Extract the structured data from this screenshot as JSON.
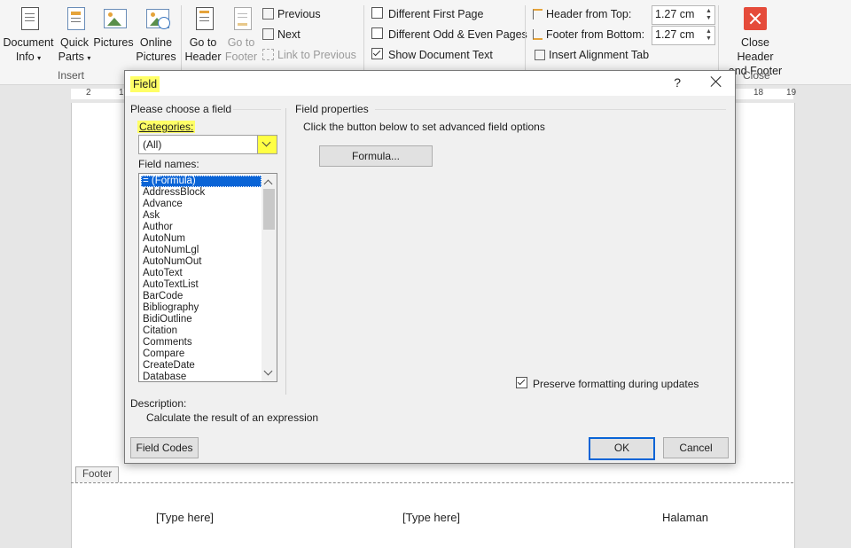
{
  "ribbon": {
    "insert_group": {
      "label": "Insert",
      "document_info": {
        "line1": "Document",
        "line2": "Info"
      },
      "quick_parts": {
        "line1": "Quick",
        "line2": "Parts"
      },
      "pictures": {
        "line1": "Pictures"
      },
      "online_pictures": {
        "line1": "Online",
        "line2": "Pictures"
      }
    },
    "navigation": {
      "go_to_header": {
        "line1": "Go to",
        "line2": "Header"
      },
      "go_to_footer": {
        "line1": "Go to",
        "line2": "Footer"
      },
      "previous": "Previous",
      "next": "Next",
      "link_to_previous": "Link to Previous"
    },
    "options": {
      "different_first_page": "Different First Page",
      "different_odd_even": "Different Odd & Even Pages",
      "show_document_text": "Show Document Text",
      "show_document_text_checked": true
    },
    "position": {
      "header_from_top_label": "Header from Top:",
      "header_from_top_value": "1.27 cm",
      "footer_from_bottom_label": "Footer from Bottom:",
      "footer_from_bottom_value": "1.27 cm",
      "insert_alignment_tab": "Insert Alignment Tab"
    },
    "close_group": {
      "label": "Close",
      "close_button": {
        "line1": "Close Header",
        "line2": "and Footer"
      }
    }
  },
  "ruler": {
    "left_marks": [
      "2",
      "1"
    ],
    "right_marks": [
      "18",
      "19"
    ]
  },
  "dialog": {
    "title": "Field",
    "help": "?",
    "choose_group_title": "Please choose a field",
    "categories_label": "Categories:",
    "categories_value": "(All)",
    "field_names_label": "Field names:",
    "field_names": [
      "= (Formula)",
      "AddressBlock",
      "Advance",
      "Ask",
      "Author",
      "AutoNum",
      "AutoNumLgl",
      "AutoNumOut",
      "AutoText",
      "AutoTextList",
      "BarCode",
      "Bibliography",
      "BidiOutline",
      "Citation",
      "Comments",
      "Compare",
      "CreateDate",
      "Database"
    ],
    "selected_index": 0,
    "properties_title": "Field properties",
    "properties_hint": "Click the button below to set advanced field options",
    "formula_button": "Formula...",
    "preserve_formatting": "Preserve formatting during updates",
    "preserve_checked": true,
    "description_label": "Description:",
    "description_text": "Calculate the result of an expression",
    "field_codes_button": "Field Codes",
    "ok_button": "OK",
    "cancel_button": "Cancel"
  },
  "document": {
    "footer_tab": "Footer",
    "footer_left": "[Type here]",
    "footer_center": "[Type here]",
    "footer_right": "Halaman"
  },
  "colors": {
    "highlight": "#ffff66",
    "selection": "#0a64d6",
    "close_red": "#e54b3a"
  }
}
